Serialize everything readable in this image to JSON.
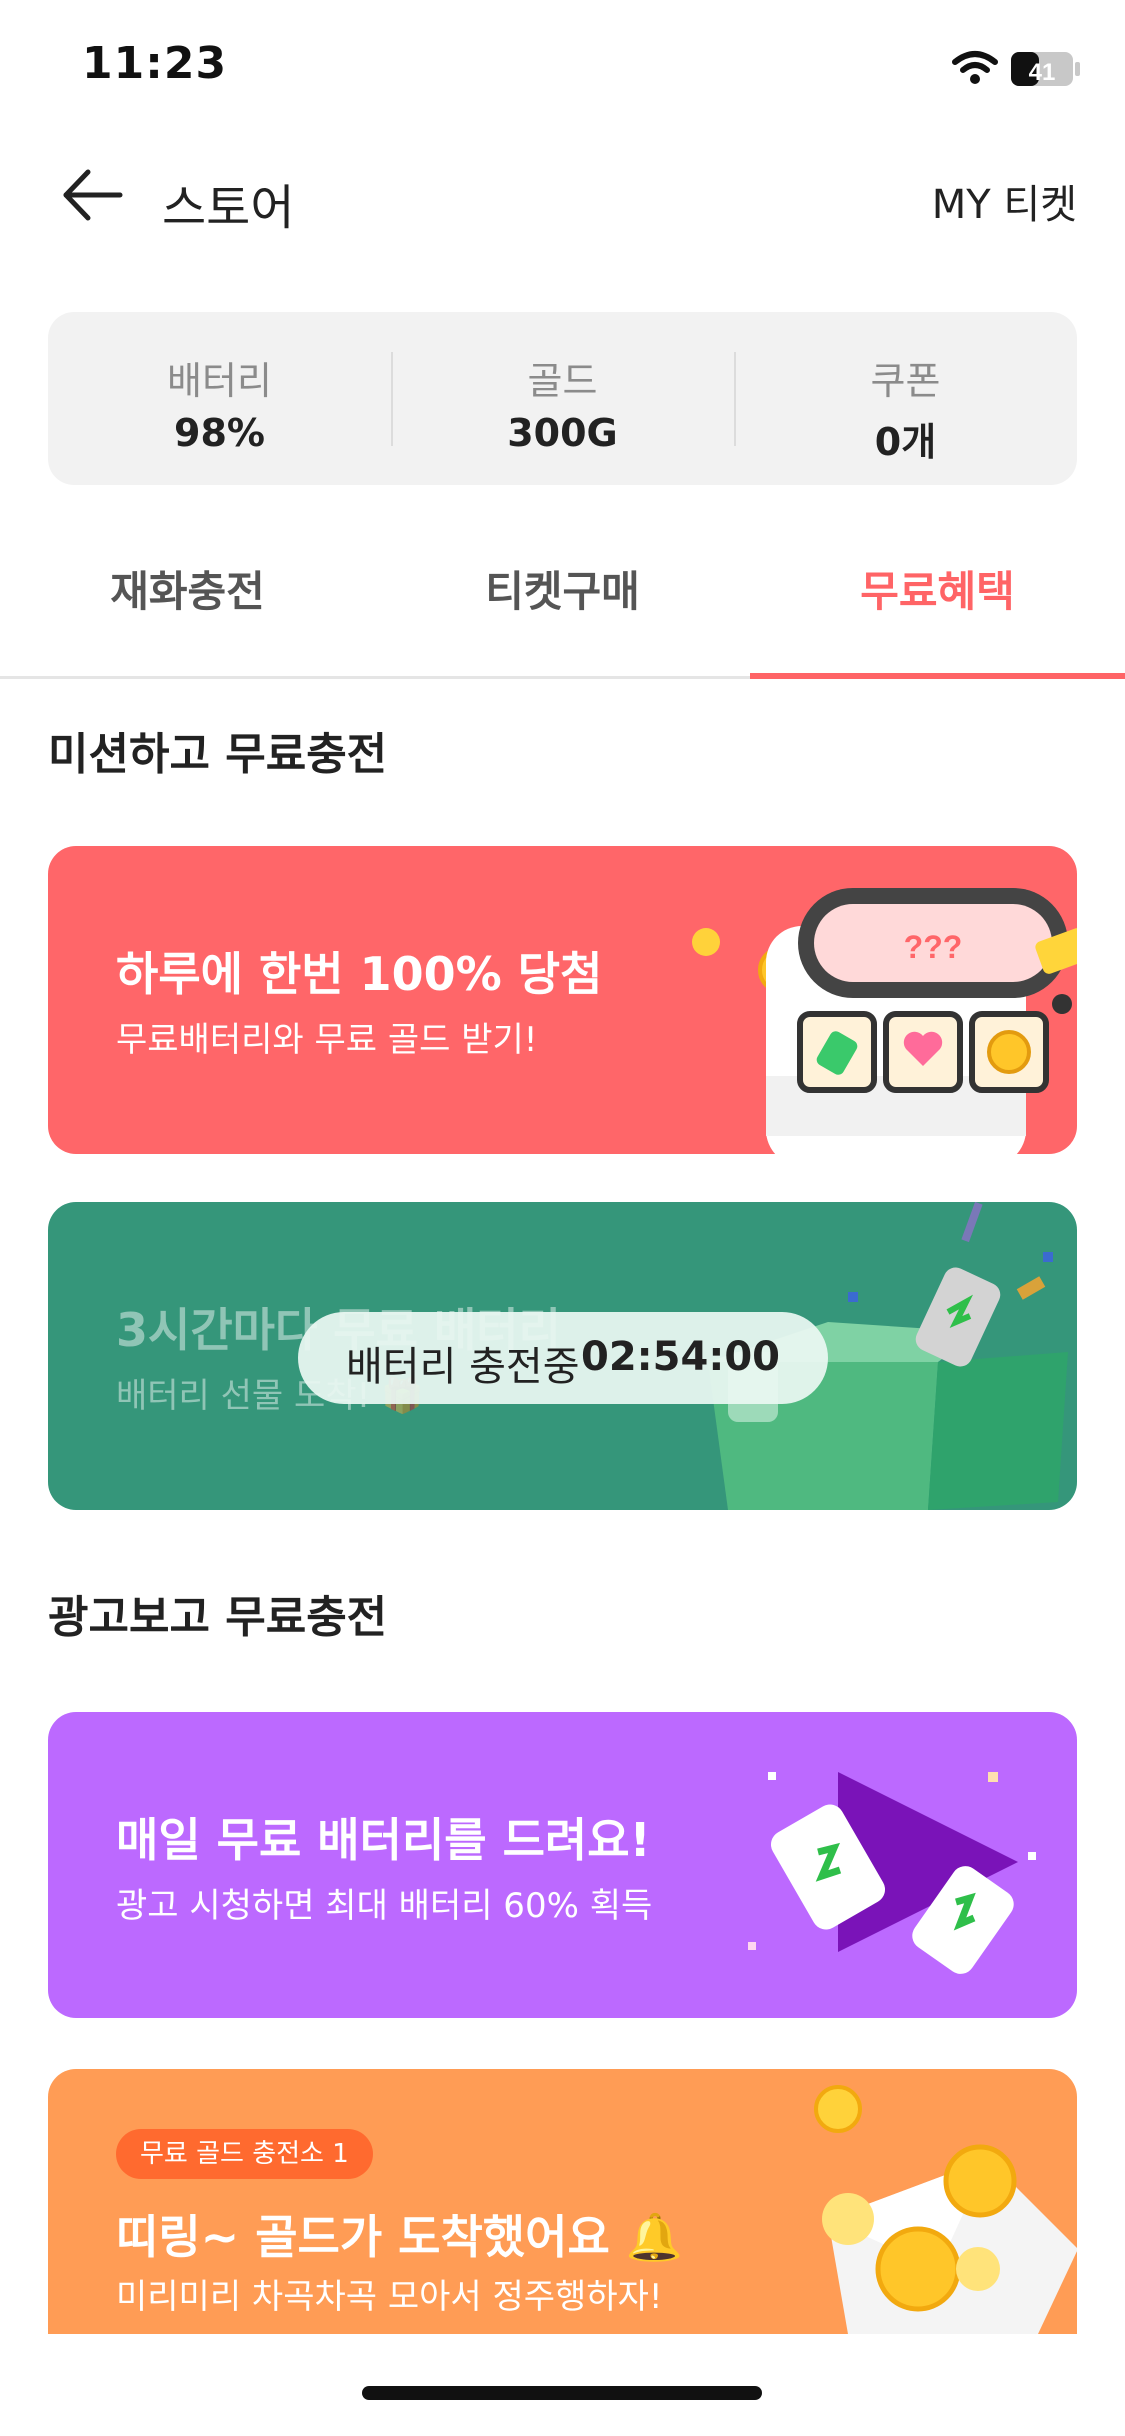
{
  "status_bar": {
    "time": "11:23",
    "battery": "41"
  },
  "header": {
    "title": "스토어",
    "my_ticket": "MY 티켓"
  },
  "summary": [
    {
      "label": "배터리",
      "value": "98%"
    },
    {
      "label": "골드",
      "value": "300G"
    },
    {
      "label": "쿠폰",
      "value": "0개"
    }
  ],
  "tabs": [
    {
      "label": "재화충전",
      "active": false
    },
    {
      "label": "티켓구매",
      "active": false
    },
    {
      "label": "무료혜택",
      "active": true
    }
  ],
  "sections": {
    "mission": "미션하고 무료충전",
    "ads": "광고보고 무료충전"
  },
  "banners": [
    {
      "title": "하루에 한번 100% 당첨",
      "subtitle": "무료배터리와 무료 골드 받기!",
      "color": "#ff6669",
      "icon": "slot-machine-icon"
    },
    {
      "title": "3시간마다 무료 배터리",
      "subtitle": "배터리 선물 도착! 🎁",
      "color": "#35967a",
      "icon": "gift-box-icon",
      "timer_label": "배터리 충전중",
      "timer_value": "02:54:00"
    },
    {
      "title": "매일 무료 배터리를 드려요!",
      "subtitle": "광고 시청하면 최대 배터리 60% 획득",
      "color": "#bc69ff",
      "icon": "play-battery-icon"
    },
    {
      "badge": "무료 골드 충전소 1",
      "title": "띠링~ 골드가 도착했어요 🔔",
      "subtitle": "미리미리 차곡차곡 모아서 정주행하자!",
      "color": "#ff9c55",
      "icon": "gold-envelope-icon"
    }
  ]
}
